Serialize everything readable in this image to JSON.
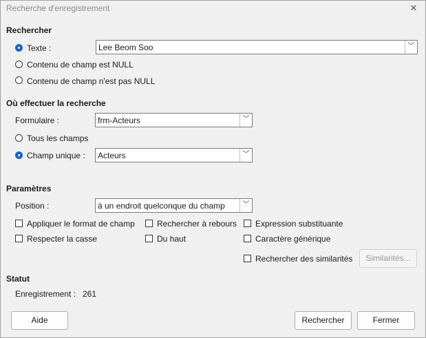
{
  "window": {
    "title": "Recherche d'enregistrement",
    "close_icon": "close-icon"
  },
  "search": {
    "heading": "Rechercher",
    "text_label": "Texte :",
    "text_value": "Lee Beom Soo",
    "null_label": "Contenu de champ est NULL",
    "not_null_label": "Contenu de champ n'est pas NULL",
    "selected": "text"
  },
  "where": {
    "heading": "Où effectuer la recherche",
    "form_label": "Formulaire :",
    "form_value": "frm-Acteurs",
    "all_fields_label": "Tous les champs",
    "single_field_label": "Champ unique :",
    "single_field_value": "Acteurs",
    "selected": "single"
  },
  "params": {
    "heading": "Paramètres",
    "position_label": "Position :",
    "position_value": "à un endroit quelconque du champ",
    "apply_format": "Appliquer le format de champ",
    "match_case": "Respecter la casse",
    "search_backwards": "Rechercher à rebours",
    "from_top": "Du haut",
    "regex": "Expression substituante",
    "wildcard": "Caractère générique",
    "similarity": "Rechercher des similarités",
    "similarities_button": "Similarités..."
  },
  "status": {
    "heading": "Statut",
    "record_label": "Enregistrement :",
    "record_value": "261"
  },
  "buttons": {
    "help": "Aide",
    "search": "Rechercher",
    "close": "Fermer"
  },
  "colors": {
    "accent": "#1b63c6",
    "background": "#f0f0f0"
  }
}
